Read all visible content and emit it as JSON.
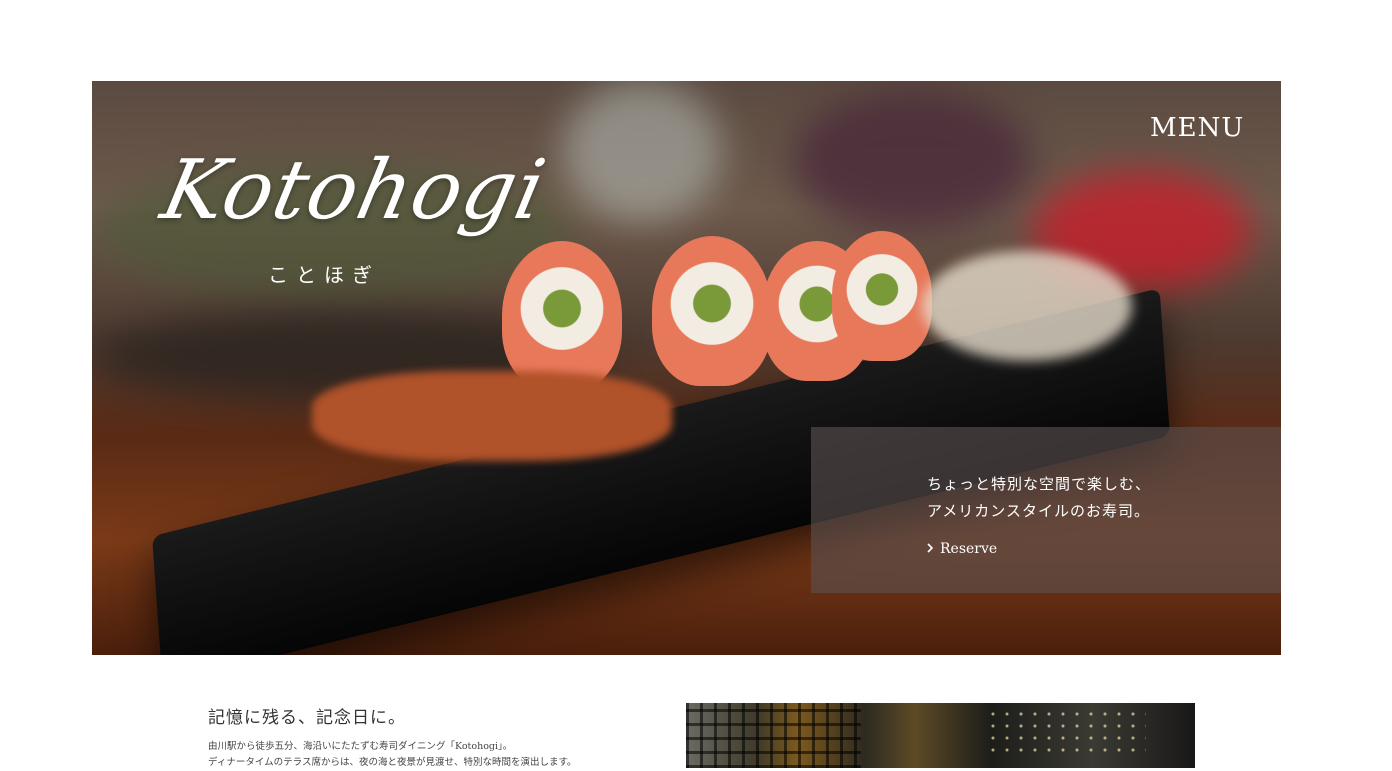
{
  "brand": {
    "logo_text": "Kotohogi",
    "logo_subtitle": "ことほぎ"
  },
  "nav": {
    "menu_label": "MENU"
  },
  "hero": {
    "tagline_line1": "ちょっと特別な空間で楽しむ、",
    "tagline_line2": "アメリカンスタイルのお寿司。",
    "reserve_icon": "chevron-right-icon",
    "reserve_label": "Reserve"
  },
  "intro": {
    "title": "記憶に残る、記念日に。",
    "body_line1": "由川駅から徒歩五分、海沿いにたたずむ寿司ダイニング「Kotohogi」。",
    "body_line2": "ディナータイムのテラス席からは、夜の海と夜景が見渡せ、特別な時間を演出します。"
  },
  "colors": {
    "overlay": "#5a5050",
    "text_dark": "#333333"
  }
}
